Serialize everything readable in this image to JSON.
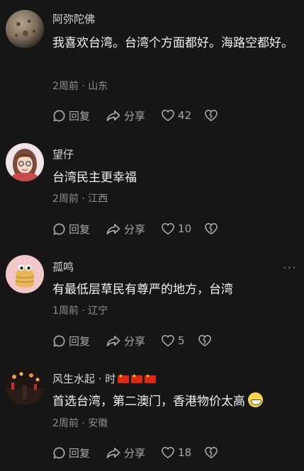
{
  "comments": [
    {
      "username": "阿弥陀佛",
      "text": "我喜欢台湾。台湾个方面都好。海路空都好。",
      "time": "2周前",
      "sep": "·",
      "location": "山东",
      "reply_label": "回复",
      "share_label": "分享",
      "likes": "42"
    },
    {
      "username": "望仔",
      "text": "台湾民主更幸福",
      "time": "2周前",
      "sep": "·",
      "location": "江西",
      "reply_label": "回复",
      "share_label": "分享",
      "likes": "10"
    },
    {
      "username": "孤鸣",
      "text": "有最低层草民有尊严的地方，台湾",
      "time": "1周前",
      "sep": "·",
      "location": "辽宁",
      "reply_label": "回复",
      "share_label": "分享",
      "likes": "5",
      "more": "···"
    },
    {
      "username": "风生水起 · 时",
      "flag_icon": "cn-flag-icon",
      "text": "首选台湾，第二澳门，香港物价太高",
      "emoji_icon": "grinning-face-icon",
      "time": "2周前",
      "sep": "·",
      "location": "安徽",
      "reply_label": "回复",
      "share_label": "分享",
      "likes": "18"
    }
  ],
  "colors": {
    "background": "#161616",
    "text": "#f2f2f2",
    "muted": "#8e8e8e"
  }
}
